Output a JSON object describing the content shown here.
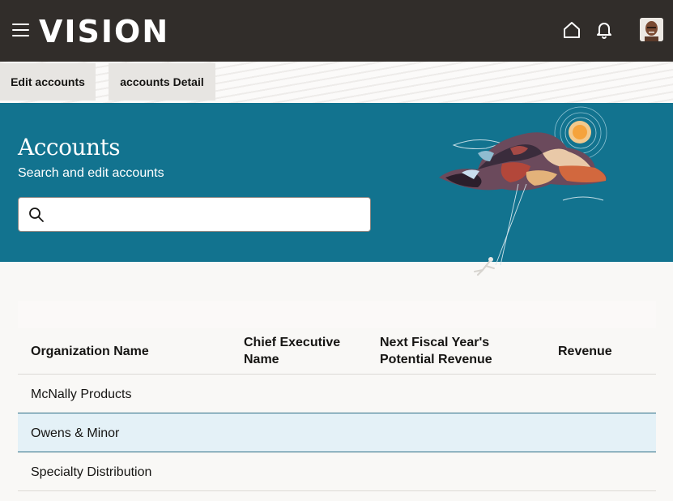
{
  "header": {
    "logo": "VISION",
    "menu_icon": "hamburger-icon",
    "home_icon": "home-icon",
    "notifications_icon": "bell-icon",
    "avatar_icon": "user-avatar"
  },
  "tabs": [
    {
      "label": "Edit accounts"
    },
    {
      "label": "accounts Detail"
    }
  ],
  "hero": {
    "title": "Accounts",
    "subtitle": "Search and edit accounts",
    "search_placeholder": "",
    "search_value": "",
    "background_color": "#12738f"
  },
  "table": {
    "columns": [
      "Organization Name",
      "Chief Executive Name",
      "Next Fiscal Year's Potential Revenue",
      "Revenue"
    ],
    "rows": [
      {
        "organization": "McNally Products",
        "ceo": "",
        "next_revenue": "",
        "revenue": "",
        "selected": false
      },
      {
        "organization": "Owens & Minor",
        "ceo": "",
        "next_revenue": "",
        "revenue": "",
        "selected": true
      },
      {
        "organization": "Specialty Distribution",
        "ceo": "",
        "next_revenue": "",
        "revenue": "",
        "selected": false
      }
    ]
  },
  "colors": {
    "header_bg": "#312d2a",
    "accent": "#12738f",
    "selected_row": "#e4f1f7"
  }
}
